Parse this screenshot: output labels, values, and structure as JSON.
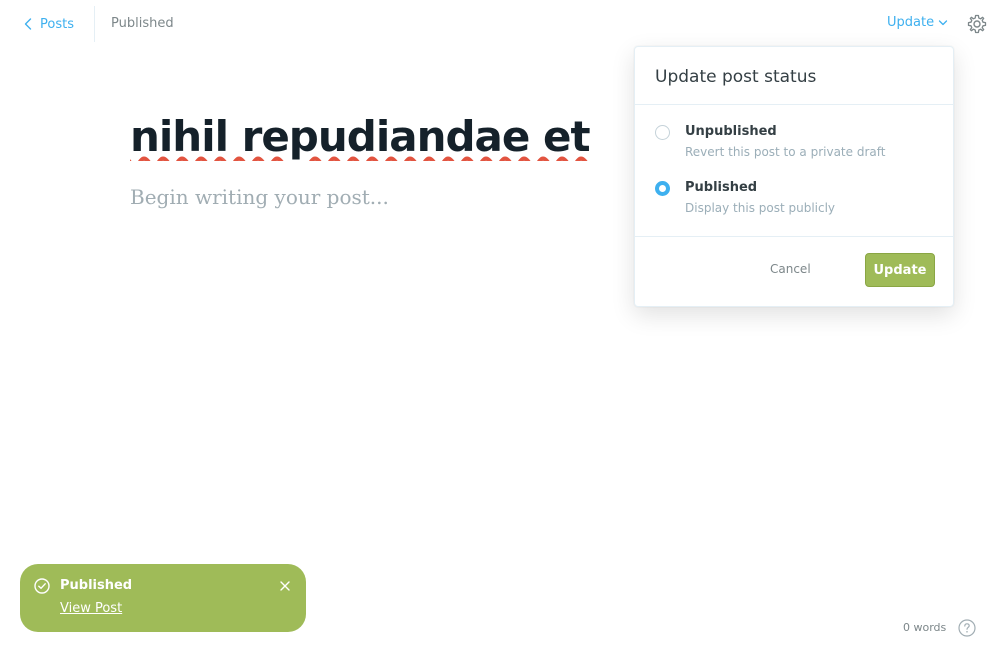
{
  "header": {
    "back_label": "Posts",
    "status": "Published",
    "update_label": "Update",
    "back_icon": "chevron-left-icon",
    "update_icon": "chevron-down-icon",
    "settings_icon": "gear-icon",
    "accent_color": "#3eb0ef"
  },
  "editor": {
    "title": "nihil repudiandae et",
    "body_placeholder": "Begin writing your post..."
  },
  "publish_menu": {
    "heading": "Update post status",
    "options": [
      {
        "title": "Unpublished",
        "description": "Revert this post to a private draft",
        "selected": false
      },
      {
        "title": "Published",
        "description": "Display this post publicly",
        "selected": true
      }
    ],
    "cancel_label": "Cancel",
    "confirm_label": "Update",
    "confirm_color": "#9fbb58"
  },
  "notification": {
    "title": "Published",
    "link_label": "View Post",
    "icon": "check-circle-icon",
    "close_icon": "close-icon",
    "color": "#9fbb58"
  },
  "footer": {
    "word_count": "0 words",
    "help_icon": "help-icon"
  }
}
